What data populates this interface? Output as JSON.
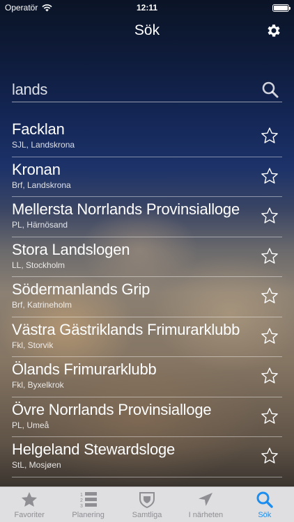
{
  "status": {
    "carrier": "Operatör",
    "time": "12:11"
  },
  "nav": {
    "title": "Sök"
  },
  "search": {
    "value": "lands"
  },
  "results": [
    {
      "title": "Facklan",
      "subtitle": "SJL, Landskrona"
    },
    {
      "title": "Kronan",
      "subtitle": "Brf, Landskrona"
    },
    {
      "title": "Mellersta Norrlands Provinsialloge",
      "subtitle": "PL, Härnösand"
    },
    {
      "title": "Stora Landslogen",
      "subtitle": "LL, Stockholm"
    },
    {
      "title": "Södermanlands Grip",
      "subtitle": "Brf, Katrineholm"
    },
    {
      "title": "Västra Gästriklands Frimurarklubb",
      "subtitle": "Fkl, Storvik"
    },
    {
      "title": "Ölands Frimurarklubb",
      "subtitle": "Fkl, Byxelkrok"
    },
    {
      "title": "Övre Norrlands Provinsialloge",
      "subtitle": "PL, Umeå"
    },
    {
      "title": "Helgeland Stewardsloge",
      "subtitle": "StL, Mosjøen"
    },
    {
      "title": "",
      "subtitle": ""
    }
  ],
  "tabs": [
    {
      "label": "Favoriter",
      "icon": "star-icon"
    },
    {
      "label": "Planering",
      "icon": "numbered-list-icon"
    },
    {
      "label": "Samtliga",
      "icon": "shield-icon"
    },
    {
      "label": "I närheten",
      "icon": "location-arrow-icon"
    },
    {
      "label": "Sök",
      "icon": "search-icon",
      "active": true
    }
  ],
  "colors": {
    "accent": "#1b8ef0",
    "tab_inactive": "#8e8e93"
  }
}
